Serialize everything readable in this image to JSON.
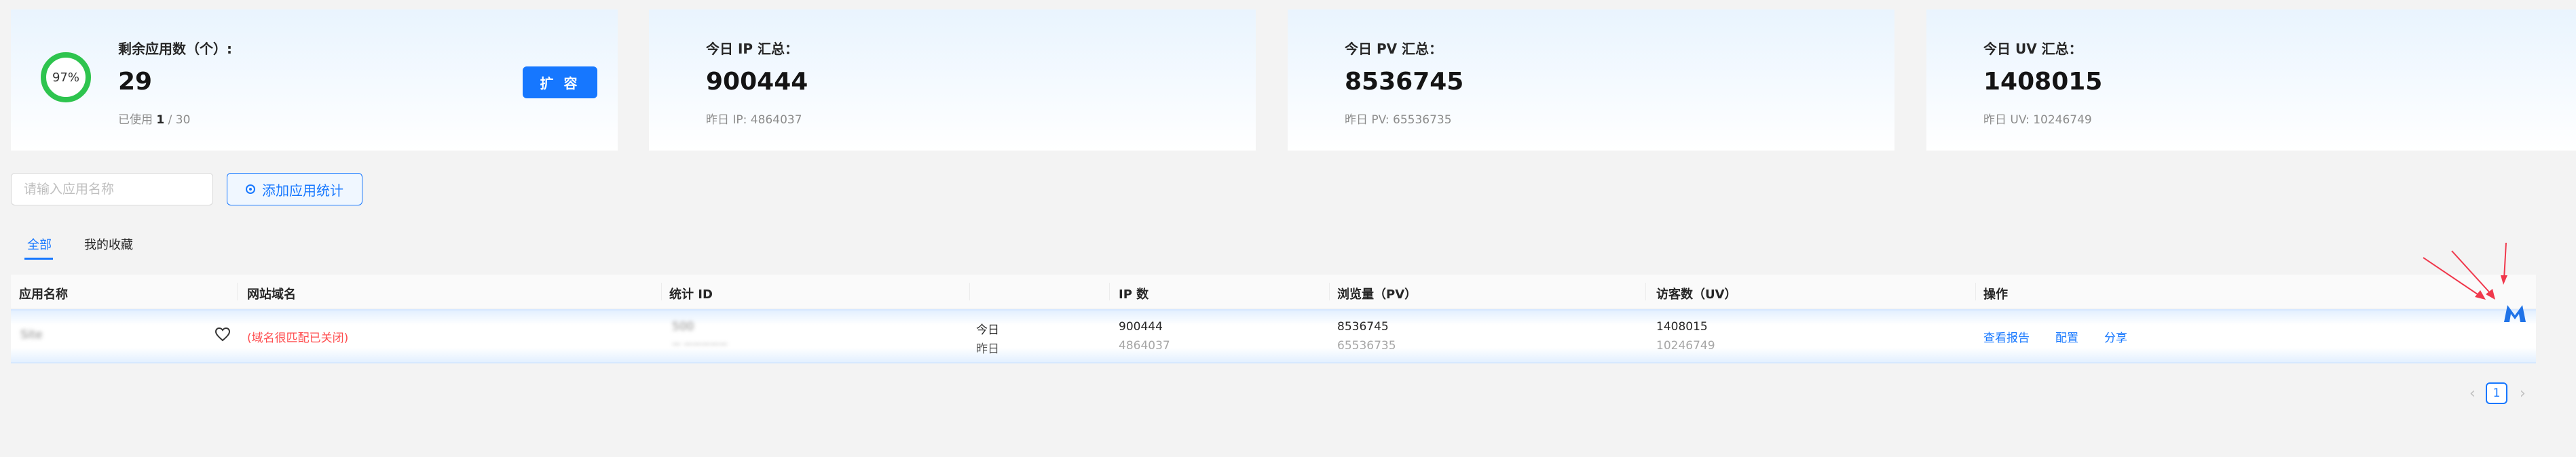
{
  "stats": {
    "remaining": {
      "title": "剩余应用数（个）:",
      "value": "29",
      "percent": "97%",
      "percent_fraction": 0.97,
      "used_label": "已使用",
      "used": "1",
      "total_sep": "/ 30",
      "expand_button": "扩 容"
    },
    "ip": {
      "title": "今日 IP 汇总：",
      "value": "900444",
      "yesterday": "昨日 IP: 4864037"
    },
    "pv": {
      "title": "今日 PV 汇总：",
      "value": "8536745",
      "yesterday": "昨日 PV: 65536735"
    },
    "uv": {
      "title": "今日 UV 汇总：",
      "value": "1408015",
      "yesterday": "昨日 UV: 10246749"
    }
  },
  "toolbar": {
    "search_placeholder": "请输入应用名称",
    "add_button": "添加应用统计"
  },
  "tabs": [
    {
      "label": "全部",
      "active": true
    },
    {
      "label": "我的收藏",
      "active": false
    }
  ],
  "table": {
    "columns": [
      "应用名称",
      "网站域名",
      "统计 ID",
      "IP 数",
      "浏览量（PV）",
      "访客数（UV）",
      "操作"
    ],
    "rows": [
      {
        "app_name": "Site",
        "domain_status": "(域名很匹配已关闭)",
        "stat_id": "500",
        "stat_id_sub": "— —————",
        "period_today": "今日",
        "period_yesterday": "昨日",
        "ip_today": "900444",
        "ip_yesterday": "4864037",
        "pv_today": "8536745",
        "pv_yesterday": "65536735",
        "uv_today": "1408015",
        "uv_yesterday": "10246749",
        "actions": [
          "查看报告",
          "配置",
          "分享"
        ]
      }
    ]
  },
  "pagination": {
    "prev": "‹",
    "current": "1",
    "next": "›"
  },
  "colors": {
    "accent": "#1677ff",
    "success": "#2ec44e",
    "danger": "#ff4d4f",
    "annotation": "#f0384c"
  },
  "icons": {
    "favorite": "heart-icon",
    "add": "add-circle-icon",
    "logo": "m-logo-icon"
  }
}
